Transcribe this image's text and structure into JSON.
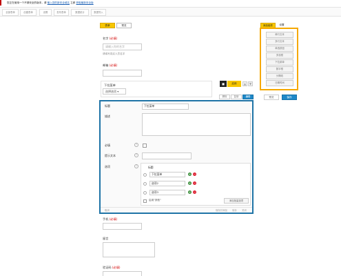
{
  "notice": {
    "text": "您正在使用一个不够安全的版本，请",
    "link1": "输入您的新安全域名",
    "mid": "立即",
    "link2": "获取最新安全版"
  },
  "toolbar": [
    "全部表单",
    "创建表单",
    "设置",
    "发布表单",
    "数据统计",
    "数据导入"
  ],
  "form": {
    "sheet_tabs": [
      "表单",
      "预览"
    ],
    "name_label": "名字",
    "required_mark": "(必填)",
    "name_placeholder": "请输入你的名字",
    "name_hint": "请填写真实人员名字",
    "email_label": "邮箱",
    "dropdown_label": "下拉菜单",
    "dropdown_value": "选择选项",
    "phone_label": "手机",
    "message_label": "留言",
    "verify_label": "验证码"
  },
  "field_tools": {
    "toggle_label": "启用",
    "tabs": [
      "删除",
      "复制",
      "编辑"
    ]
  },
  "editor": {
    "title_label": "标题",
    "title_value": "下拉菜单",
    "desc_label": "描述",
    "required_label": "必填",
    "prompt_label": "提示文本",
    "options_label": "选项",
    "options_header": "标题",
    "options": [
      "下拉菜单",
      "选项2",
      "选项3"
    ],
    "other_label": "启用\"其他\"",
    "bulk_button": "添加批量选项",
    "footer_left": "取消",
    "footer_right": [
      "保存并添加",
      "保存",
      "关闭"
    ]
  },
  "widgets": {
    "tabs": [
      "添加组件",
      "设置"
    ],
    "items": [
      "单行文本",
      "多行文本",
      "单选按钮",
      "多选框",
      "下拉菜单",
      "数字框",
      "分隔线",
      "日期时间",
      "附件"
    ],
    "preview_button": "预览",
    "save_button": "保存"
  },
  "colors": {
    "accent_yellow": "#f5a800",
    "editor_blue": "#1e73a6",
    "required_red": "#d20000"
  }
}
